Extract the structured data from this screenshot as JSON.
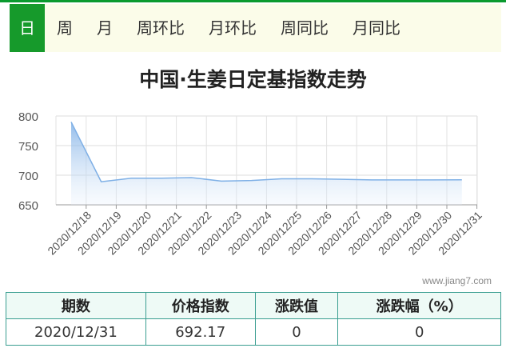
{
  "tabs": [
    "日",
    "周",
    "月",
    "周环比",
    "月环比",
    "周同比",
    "月同比"
  ],
  "active_tab": 0,
  "colors": {
    "accent": "#169a2b",
    "line": "#7fb0e6",
    "table_border": "#3a9e91"
  },
  "watermark": "www.jiang7.com",
  "chart_data": {
    "type": "area",
    "title": "中国·生姜日定基指数走势",
    "x": [
      "2020/12/18",
      "2020/12/19",
      "2020/12/20",
      "2020/12/21",
      "2020/12/22",
      "2020/12/23",
      "2020/12/24",
      "2020/12/25",
      "2020/12/26",
      "2020/12/27",
      "2020/12/28",
      "2020/12/29",
      "2020/12/30",
      "2020/12/31"
    ],
    "values": [
      790,
      689,
      695,
      695,
      696,
      690,
      691,
      694,
      694,
      693,
      692,
      692,
      692,
      692.17
    ],
    "ylim": [
      650,
      800
    ],
    "yticks": [
      650,
      700,
      750,
      800
    ],
    "grid": true
  },
  "table": {
    "headers": [
      "期数",
      "价格指数",
      "涨跌值",
      "涨跌幅（%）"
    ],
    "rows": [
      [
        "2020/12/31",
        "692.17",
        "0",
        "0"
      ]
    ]
  }
}
